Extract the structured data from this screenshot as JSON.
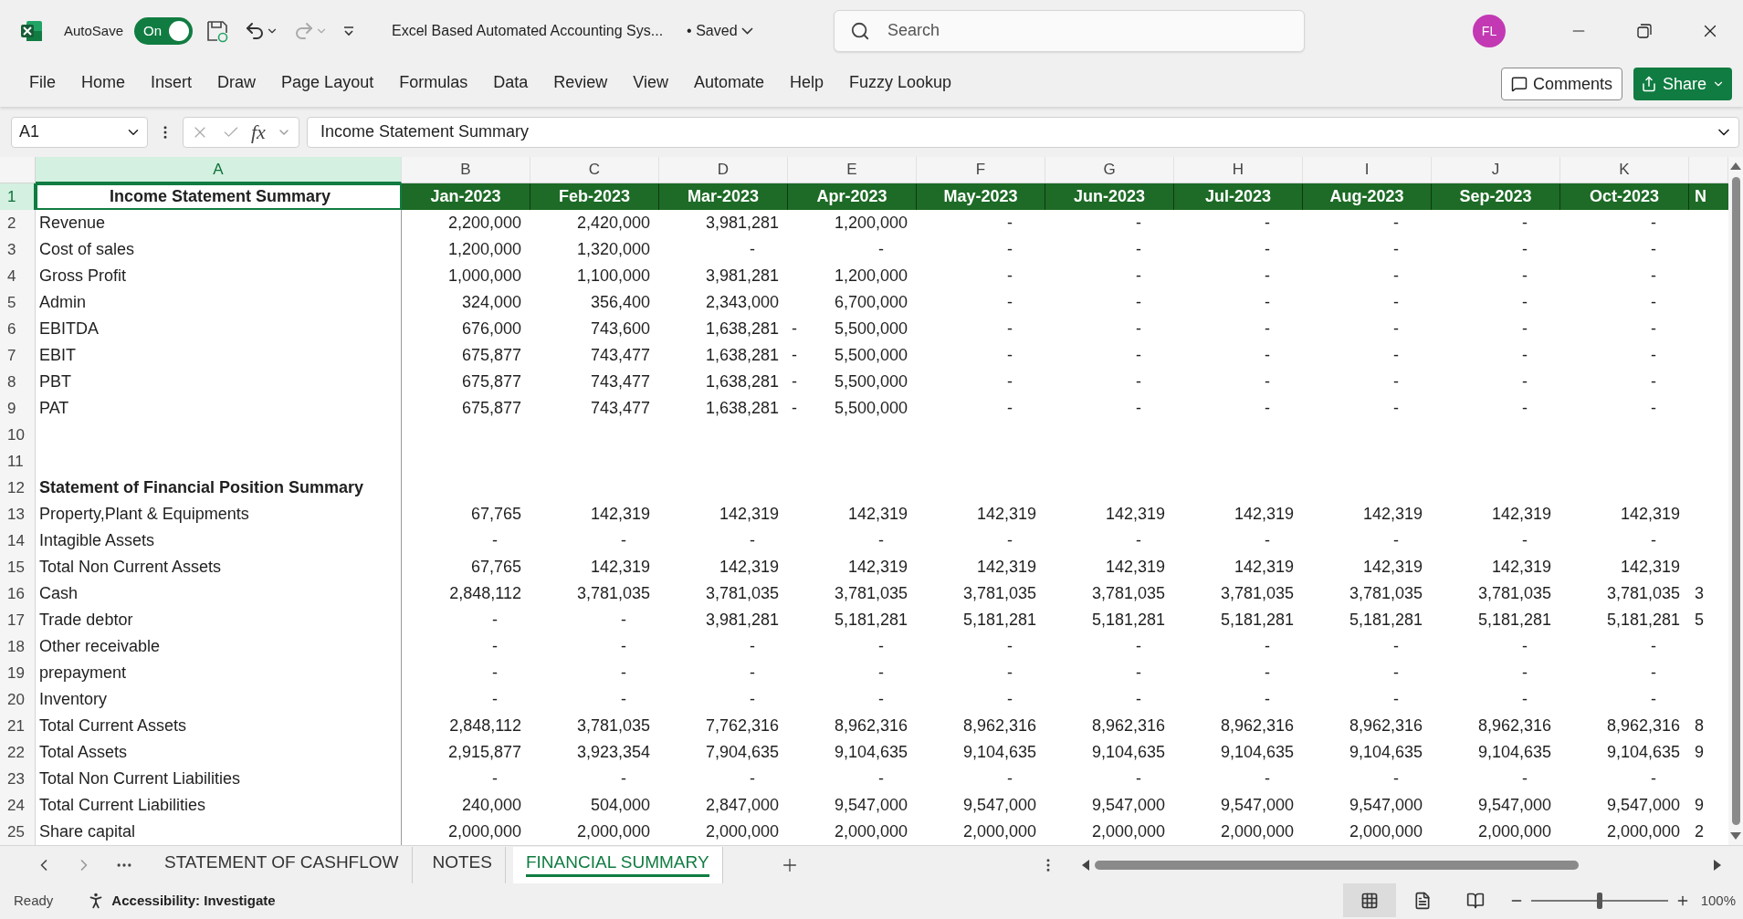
{
  "window": {
    "title": "Excel Based Automated Accounting Sys...",
    "save_state": "• Saved"
  },
  "autosave": {
    "label": "AutoSave",
    "on": true,
    "state": "On"
  },
  "search": {
    "placeholder": "Search"
  },
  "account": {
    "initials": "FL"
  },
  "ribbon_tabs": [
    {
      "label": "File",
      "selected": false
    },
    {
      "label": "Home",
      "selected": false
    },
    {
      "label": "Insert",
      "selected": false
    },
    {
      "label": "Draw",
      "selected": false
    },
    {
      "label": "Page Layout",
      "selected": false
    },
    {
      "label": "Formulas",
      "selected": false
    },
    {
      "label": "Data",
      "selected": false
    },
    {
      "label": "Review",
      "selected": false
    },
    {
      "label": "View",
      "selected": false
    },
    {
      "label": "Automate",
      "selected": false
    },
    {
      "label": "Help",
      "selected": false
    },
    {
      "label": "Fuzzy Lookup",
      "selected": false
    }
  ],
  "ribbon_buttons": {
    "comments": "Comments",
    "share": "Share"
  },
  "formula_bar": {
    "name_box": "A1",
    "fx": "fx",
    "formula": "Income Statement Summary"
  },
  "sheet": {
    "columns": [
      {
        "letter": "A",
        "selected": true
      },
      {
        "letter": "B",
        "selected": false
      },
      {
        "letter": "C",
        "selected": false
      },
      {
        "letter": "D",
        "selected": false
      },
      {
        "letter": "E",
        "selected": false
      },
      {
        "letter": "F",
        "selected": false
      },
      {
        "letter": "G",
        "selected": false
      },
      {
        "letter": "H",
        "selected": false
      },
      {
        "letter": "I",
        "selected": false
      },
      {
        "letter": "J",
        "selected": false
      },
      {
        "letter": "K",
        "selected": false
      }
    ],
    "rows": [
      {
        "number": "1",
        "selected": true,
        "kind": "header",
        "label": "Income Statement Summary",
        "values": [
          "Jan-2023",
          "Feb-2023",
          "Mar-2023",
          "Apr-2023",
          "May-2023",
          "Jun-2023",
          "Jul-2023",
          "Aug-2023",
          "Sep-2023",
          "Oct-2023"
        ],
        "overflow": "N"
      },
      {
        "number": "2",
        "selected": false,
        "kind": "data",
        "label": "Revenue",
        "values": [
          "2,200,000",
          "2,420,000",
          "3,981,281",
          "1,200,000",
          {
            "zero": "-"
          },
          {
            "zero": "-"
          },
          {
            "zero": "-"
          },
          {
            "zero": "-"
          },
          {
            "zero": "-"
          },
          {
            "zero": "-"
          }
        ]
      },
      {
        "number": "3",
        "selected": false,
        "kind": "data",
        "label": "Cost of sales",
        "values": [
          "1,200,000",
          "1,320,000",
          {
            "zero": "-"
          },
          {
            "zero": "-"
          },
          {
            "zero": "-"
          },
          {
            "zero": "-"
          },
          {
            "zero": "-"
          },
          {
            "zero": "-"
          },
          {
            "zero": "-"
          },
          {
            "zero": "-"
          }
        ]
      },
      {
        "number": "4",
        "selected": false,
        "kind": "data",
        "label": "Gross Profit",
        "values": [
          "1,000,000",
          "1,100,000",
          "3,981,281",
          "1,200,000",
          {
            "zero": "-"
          },
          {
            "zero": "-"
          },
          {
            "zero": "-"
          },
          {
            "zero": "-"
          },
          {
            "zero": "-"
          },
          {
            "zero": "-"
          }
        ]
      },
      {
        "number": "5",
        "selected": false,
        "kind": "data",
        "label": "Admin",
        "values": [
          "324,000",
          "356,400",
          "2,343,000",
          "6,700,000",
          {
            "zero": "-"
          },
          {
            "zero": "-"
          },
          {
            "zero": "-"
          },
          {
            "zero": "-"
          },
          {
            "zero": "-"
          },
          {
            "zero": "-"
          }
        ]
      },
      {
        "number": "6",
        "selected": false,
        "kind": "data",
        "label": "EBITDA",
        "values": [
          "676,000",
          "743,600",
          "1,638,281",
          {
            "sign": "-",
            "value": "5,500,000"
          },
          {
            "zero": "-"
          },
          {
            "zero": "-"
          },
          {
            "zero": "-"
          },
          {
            "zero": "-"
          },
          {
            "zero": "-"
          },
          {
            "zero": "-"
          }
        ]
      },
      {
        "number": "7",
        "selected": false,
        "kind": "data",
        "label": "EBIT",
        "values": [
          "675,877",
          "743,477",
          "1,638,281",
          {
            "sign": "-",
            "value": "5,500,000"
          },
          {
            "zero": "-"
          },
          {
            "zero": "-"
          },
          {
            "zero": "-"
          },
          {
            "zero": "-"
          },
          {
            "zero": "-"
          },
          {
            "zero": "-"
          }
        ]
      },
      {
        "number": "8",
        "selected": false,
        "kind": "data",
        "label": "PBT",
        "values": [
          "675,877",
          "743,477",
          "1,638,281",
          {
            "sign": "-",
            "value": "5,500,000"
          },
          {
            "zero": "-"
          },
          {
            "zero": "-"
          },
          {
            "zero": "-"
          },
          {
            "zero": "-"
          },
          {
            "zero": "-"
          },
          {
            "zero": "-"
          }
        ]
      },
      {
        "number": "9",
        "selected": false,
        "kind": "data",
        "label": "PAT",
        "values": [
          "675,877",
          "743,477",
          "1,638,281",
          {
            "sign": "-",
            "value": "5,500,000"
          },
          {
            "zero": "-"
          },
          {
            "zero": "-"
          },
          {
            "zero": "-"
          },
          {
            "zero": "-"
          },
          {
            "zero": "-"
          },
          {
            "zero": "-"
          }
        ]
      },
      {
        "number": "10",
        "selected": false,
        "kind": "blank"
      },
      {
        "number": "11",
        "selected": false,
        "kind": "blank"
      },
      {
        "number": "12",
        "selected": false,
        "kind": "section",
        "label": "Statement of Financial Position Summary"
      },
      {
        "number": "13",
        "selected": false,
        "kind": "data",
        "label": "Property,Plant & Equipments",
        "values": [
          "67,765",
          "142,319",
          "142,319",
          "142,319",
          "142,319",
          "142,319",
          "142,319",
          "142,319",
          "142,319",
          "142,319"
        ]
      },
      {
        "number": "14",
        "selected": false,
        "kind": "data",
        "label": "Intagible Assets",
        "values": [
          {
            "zero": "-"
          },
          {
            "zero": "-"
          },
          {
            "zero": "-"
          },
          {
            "zero": "-"
          },
          {
            "zero": "-"
          },
          {
            "zero": "-"
          },
          {
            "zero": "-"
          },
          {
            "zero": "-"
          },
          {
            "zero": "-"
          },
          {
            "zero": "-"
          }
        ]
      },
      {
        "number": "15",
        "selected": false,
        "kind": "data",
        "label": "Total Non Current Assets",
        "values": [
          "67,765",
          "142,319",
          "142,319",
          "142,319",
          "142,319",
          "142,319",
          "142,319",
          "142,319",
          "142,319",
          "142,319"
        ]
      },
      {
        "number": "16",
        "selected": false,
        "kind": "data",
        "label": "Cash",
        "values": [
          "2,848,112",
          "3,781,035",
          "3,781,035",
          "3,781,035",
          "3,781,035",
          "3,781,035",
          "3,781,035",
          "3,781,035",
          "3,781,035",
          "3,781,035"
        ],
        "overflow": "3"
      },
      {
        "number": "17",
        "selected": false,
        "kind": "data",
        "label": "Trade debtor",
        "values": [
          {
            "zero": "-"
          },
          {
            "zero": "-"
          },
          "3,981,281",
          "5,181,281",
          "5,181,281",
          "5,181,281",
          "5,181,281",
          "5,181,281",
          "5,181,281",
          "5,181,281"
        ],
        "overflow": "5"
      },
      {
        "number": "18",
        "selected": false,
        "kind": "data",
        "label": "Other receivable",
        "values": [
          {
            "zero": "-"
          },
          {
            "zero": "-"
          },
          {
            "zero": "-"
          },
          {
            "zero": "-"
          },
          {
            "zero": "-"
          },
          {
            "zero": "-"
          },
          {
            "zero": "-"
          },
          {
            "zero": "-"
          },
          {
            "zero": "-"
          },
          {
            "zero": "-"
          }
        ]
      },
      {
        "number": "19",
        "selected": false,
        "kind": "data",
        "label": "prepayment",
        "values": [
          {
            "zero": "-"
          },
          {
            "zero": "-"
          },
          {
            "zero": "-"
          },
          {
            "zero": "-"
          },
          {
            "zero": "-"
          },
          {
            "zero": "-"
          },
          {
            "zero": "-"
          },
          {
            "zero": "-"
          },
          {
            "zero": "-"
          },
          {
            "zero": "-"
          }
        ]
      },
      {
        "number": "20",
        "selected": false,
        "kind": "data",
        "label": "Inventory",
        "values": [
          {
            "zero": "-"
          },
          {
            "zero": "-"
          },
          {
            "zero": "-"
          },
          {
            "zero": "-"
          },
          {
            "zero": "-"
          },
          {
            "zero": "-"
          },
          {
            "zero": "-"
          },
          {
            "zero": "-"
          },
          {
            "zero": "-"
          },
          {
            "zero": "-"
          }
        ]
      },
      {
        "number": "21",
        "selected": false,
        "kind": "data",
        "label": "Total Current Assets",
        "values": [
          "2,848,112",
          "3,781,035",
          "7,762,316",
          "8,962,316",
          "8,962,316",
          "8,962,316",
          "8,962,316",
          "8,962,316",
          "8,962,316",
          "8,962,316"
        ],
        "overflow": "8"
      },
      {
        "number": "22",
        "selected": false,
        "kind": "data",
        "label": "Total Assets",
        "values": [
          "2,915,877",
          "3,923,354",
          "7,904,635",
          "9,104,635",
          "9,104,635",
          "9,104,635",
          "9,104,635",
          "9,104,635",
          "9,104,635",
          "9,104,635"
        ],
        "overflow": "9"
      },
      {
        "number": "23",
        "selected": false,
        "kind": "data",
        "label": "Total Non Current Liabilities",
        "values": [
          {
            "zero": "-"
          },
          {
            "zero": "-"
          },
          {
            "zero": "-"
          },
          {
            "zero": "-"
          },
          {
            "zero": "-"
          },
          {
            "zero": "-"
          },
          {
            "zero": "-"
          },
          {
            "zero": "-"
          },
          {
            "zero": "-"
          },
          {
            "zero": "-"
          }
        ]
      },
      {
        "number": "24",
        "selected": false,
        "kind": "data",
        "label": "Total Current Liabilities",
        "values": [
          "240,000",
          "504,000",
          "2,847,000",
          "9,547,000",
          "9,547,000",
          "9,547,000",
          "9,547,000",
          "9,547,000",
          "9,547,000",
          "9,547,000"
        ],
        "overflow": "9"
      },
      {
        "number": "25",
        "selected": false,
        "kind": "data",
        "label": "Share capital",
        "values": [
          "2,000,000",
          "2,000,000",
          "2,000,000",
          "2,000,000",
          "2,000,000",
          "2,000,000",
          "2,000,000",
          "2,000,000",
          "2,000,000",
          "2,000,000"
        ],
        "overflow": "2"
      }
    ]
  },
  "sheet_tabs": [
    {
      "label": "STATEMENT OF CASHFLOW",
      "selected": false
    },
    {
      "label": "NOTES",
      "selected": false
    },
    {
      "label": "FINANCIAL SUMMARY",
      "selected": true
    }
  ],
  "status_bar": {
    "ready": "Ready",
    "accessibility": "Accessibility: Investigate",
    "zoom": "100%"
  },
  "zoom_slider": {
    "level": 0.5
  }
}
